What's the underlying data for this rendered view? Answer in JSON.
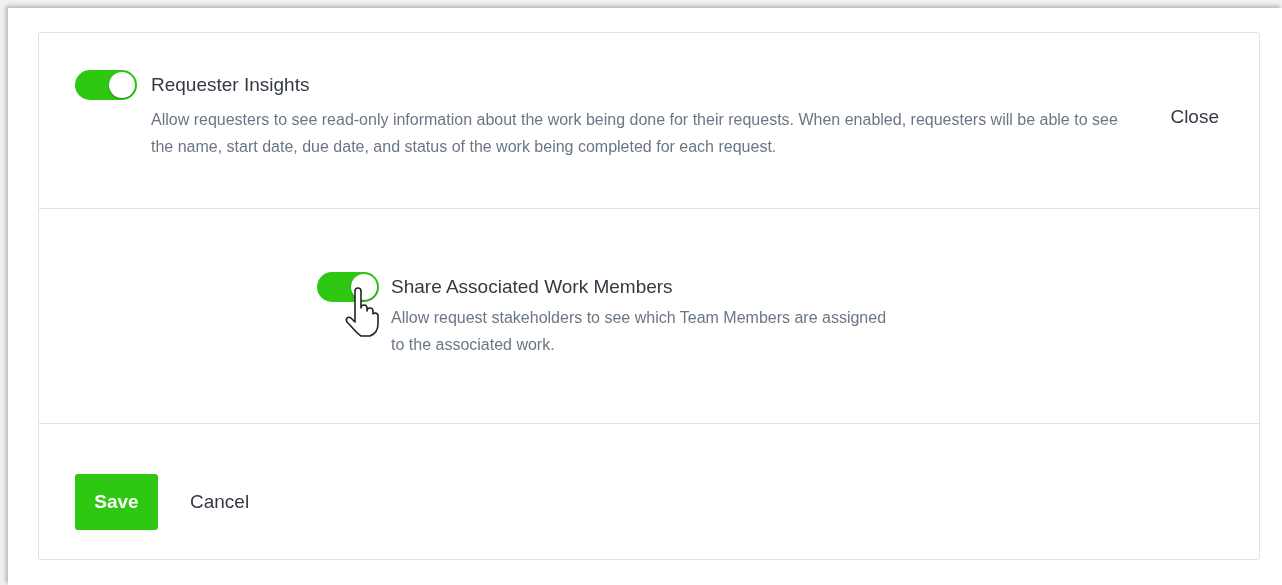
{
  "main_setting": {
    "title": "Requester Insights",
    "description": "Allow requesters to see read-only information about the work being done for their requests. When enabled, requesters will be able to see the name, start date, due date, and status of the work being completed for each request.",
    "on": true
  },
  "close": "Close",
  "sub_setting": {
    "title": "Share Associated Work Members",
    "description": "Allow request stakeholders to see which Team Members are assigned to the associated work.",
    "on": true
  },
  "buttons": {
    "save": "Save",
    "cancel": "Cancel"
  }
}
